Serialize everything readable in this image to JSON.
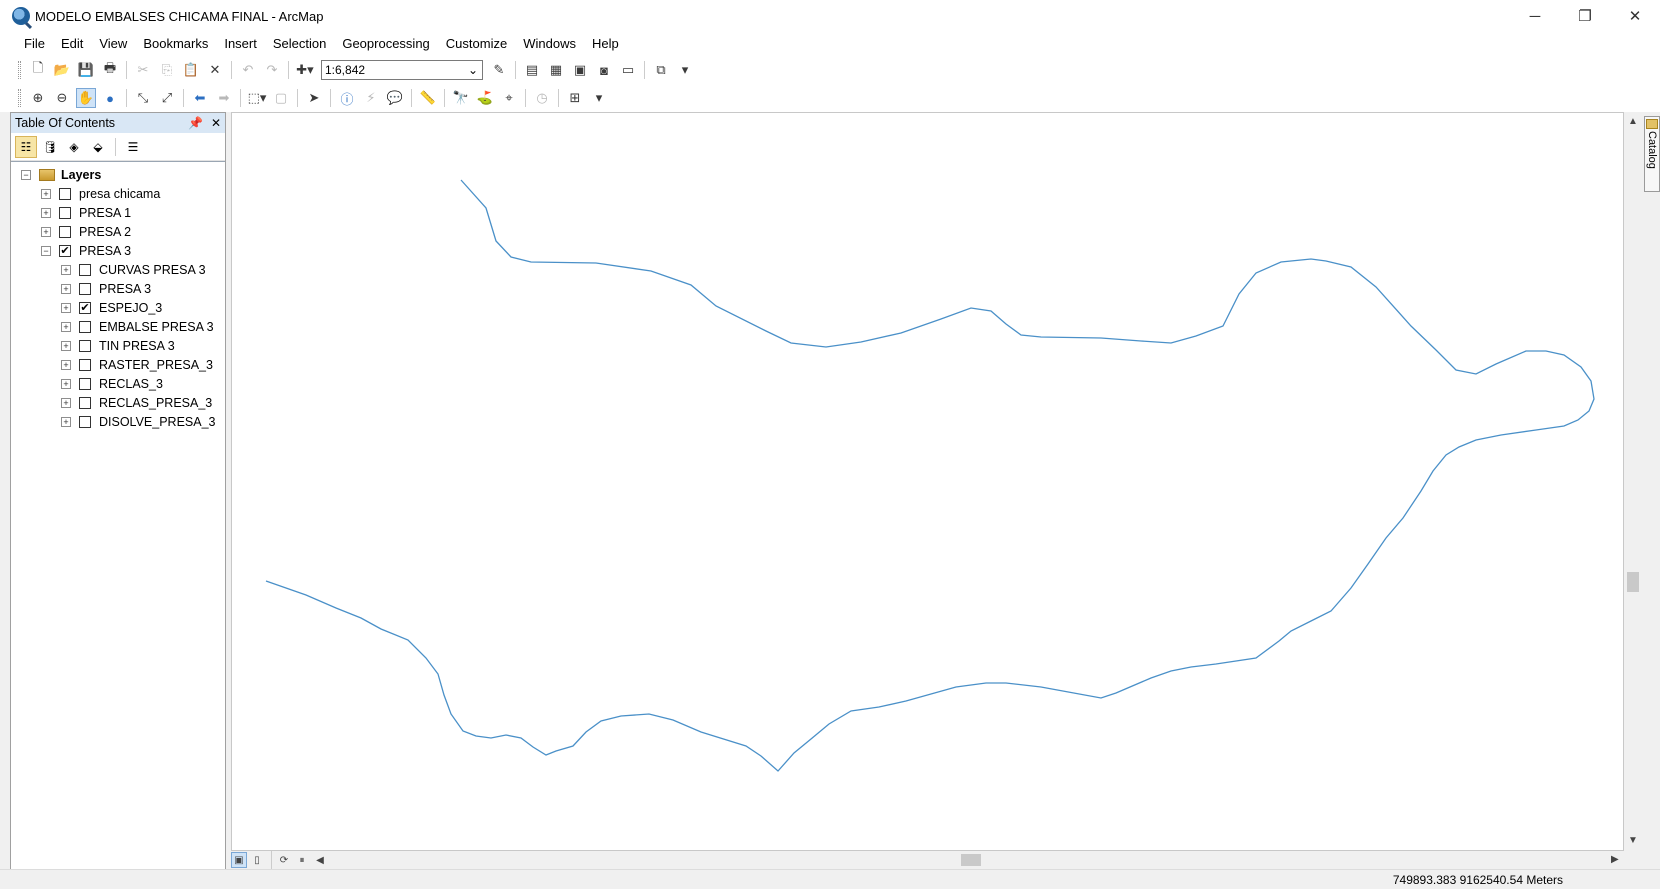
{
  "window": {
    "title": "MODELO EMBALSES CHICAMA FINAL - ArcMap",
    "controls": {
      "minimize": "─",
      "restore": "❐",
      "close": "✕"
    }
  },
  "menu": [
    "File",
    "Edit",
    "View",
    "Bookmarks",
    "Insert",
    "Selection",
    "Geoprocessing",
    "Customize",
    "Windows",
    "Help"
  ],
  "standard_toolbar": {
    "scale": "1:6,842"
  },
  "toc": {
    "title": "Table Of Contents",
    "pin_glyph": "📌",
    "close_glyph": "✕",
    "root": "Layers",
    "layers": [
      {
        "label": "presa chicama",
        "checked": false,
        "expanded": false
      },
      {
        "label": "PRESA 1",
        "checked": false,
        "expanded": false
      },
      {
        "label": "PRESA 2",
        "checked": false,
        "expanded": false
      },
      {
        "label": "PRESA 3",
        "checked": true,
        "expanded": true
      }
    ],
    "sublayers": [
      {
        "label": "CURVAS PRESA 3",
        "checked": false
      },
      {
        "label": "PRESA 3",
        "checked": false
      },
      {
        "label": "ESPEJO_3",
        "checked": true
      },
      {
        "label": "EMBALSE PRESA 3",
        "checked": false
      },
      {
        "label": "TIN PRESA 3",
        "checked": false
      },
      {
        "label": "RASTER_PRESA_3",
        "checked": false
      },
      {
        "label": "RECLAS_3",
        "checked": false
      },
      {
        "label": "RECLAS_PRESA_3",
        "checked": false
      },
      {
        "label": "DISOLVE_PRESA_3",
        "checked": false
      }
    ]
  },
  "map": {
    "line_color": "#4a90c8"
  },
  "catalog_tab": "Catalog",
  "status": {
    "coordinates": "749893.383  9162540.54 Meters"
  }
}
